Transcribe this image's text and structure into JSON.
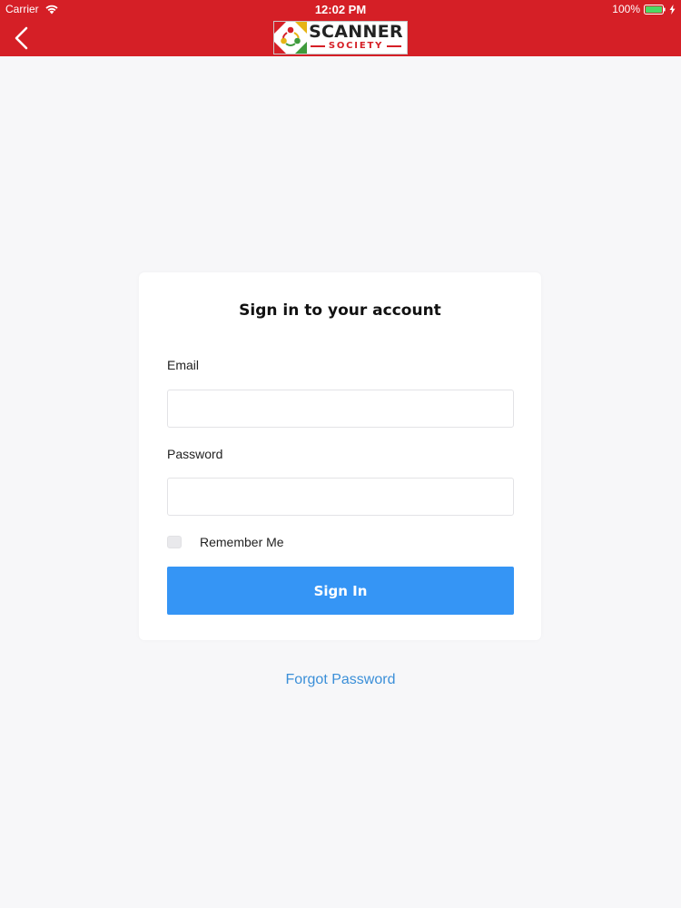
{
  "status_bar": {
    "carrier": "Carrier",
    "time": "12:02 PM",
    "battery": "100%"
  },
  "nav": {
    "back_icon": "chevron-left-icon",
    "logo": {
      "top_text": "SCANNER",
      "bottom_text": "SOCIETY"
    }
  },
  "colors": {
    "header": "#d51f26",
    "button": "#3595f5",
    "link": "#3b8fd8",
    "battery_fill": "#4cd964"
  },
  "form": {
    "title": "Sign in to your account",
    "email_label": "Email",
    "email_value": "",
    "password_label": "Password",
    "password_value": "",
    "remember_label": "Remember Me",
    "remember_checked": false,
    "submit_label": "Sign In"
  },
  "forgot_password": "Forgot Password"
}
